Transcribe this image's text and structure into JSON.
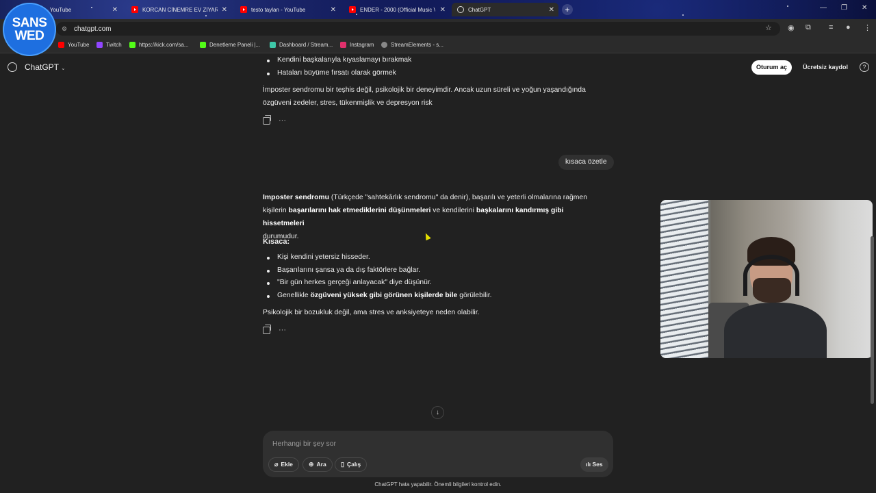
{
  "browser": {
    "tabs": [
      {
        "title": "- YouTube",
        "active": false
      },
      {
        "title": "KORCAN CİNEMRE EV ZİYARETİ",
        "active": false
      },
      {
        "title": "testo taylan - YouTube",
        "active": false
      },
      {
        "title": "ENDER - 2000 (Official Music V",
        "active": false
      },
      {
        "title": "ChatGPT",
        "active": true
      }
    ],
    "new_tab": "+",
    "window_controls": [
      "—",
      "❐",
      "✕"
    ],
    "url": "chatgpt.com",
    "bookmarks": [
      "YouTube",
      "Twitch",
      "https://kick.com/sa...",
      "Denetleme Paneli |...",
      "Dashboard / Stream...",
      "Instagram",
      "StreamElements - s..."
    ]
  },
  "logo": {
    "line1": "SANS",
    "line2": "WED"
  },
  "header": {
    "title": "ChatGPT",
    "login": "Oturum aç",
    "signup": "Ücretsiz kaydol",
    "help": "?"
  },
  "conversation": {
    "prev_bullets": [
      "Kendini başkalarıyla kıyaslamayı bırakmak",
      "Hataları büyüme fırsatı olarak görmek"
    ],
    "prev_paragraph_1": "İmposter sendromu bir teşhis değil, psikolojik bir deneyimdir. Ancak uzun süreli ve yoğun yaşandığında",
    "prev_paragraph_2": "özgüveni zedeler, stres, tükenmişlik ve depresyon risk",
    "user_message": "kısaca özetle",
    "answer": {
      "intro_bold_1": "Imposter sendromu",
      "intro_text_1": " (Türkçede \"sahtekârlık sendromu\" da denir), başarılı ve yeterli olmalarına rağmen",
      "intro_text_2": "kişilerin ",
      "intro_bold_2": "başarılarını hak etmediklerini düşünmeleri",
      "intro_text_3": " ve kendilerini ",
      "intro_bold_3": "başkalarını kandırmış gibi hissetmeleri",
      "intro_text_4": "durumudur.",
      "heading": "Kısaca:",
      "bullets": [
        "Kişi kendini yetersiz hisseder.",
        "Başarılarını şansa ya da dış faktörlere bağlar.",
        "\"Bir gün herkes gerçeği anlayacak\" diye düşünür."
      ],
      "bullet4_pre": "Genellikle ",
      "bullet4_bold": "özgüveni yüksek gibi görünen kişilerde bile",
      "bullet4_post": " görülebilir.",
      "closing": "Psikolojik bir bozukluk değil, ama stres ve anksiyeteye neden olabilir."
    },
    "more": "···"
  },
  "composer": {
    "placeholder": "Herhangi bir şey sor",
    "attach": "Ekle",
    "search": "Ara",
    "study": "Çalış",
    "voice": "Ses"
  },
  "disclaimer": "ChatGPT hata yapabilir. Önemli bilgileri kontrol edin."
}
